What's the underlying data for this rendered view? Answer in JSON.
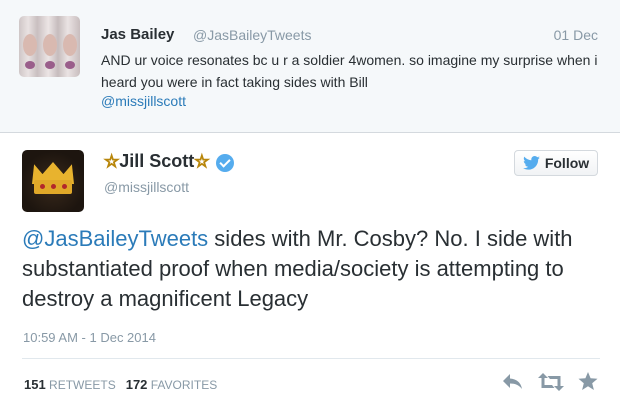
{
  "reply_context": {
    "author_name": "Jas Bailey",
    "author_handle": "@JasBaileyTweets",
    "date": "01 Dec",
    "text": "AND ur voice resonates bc u r a soldier 4women. so imagine my surprise when i heard you were in fact taking sides with Bill",
    "mention": "@missjillscott"
  },
  "tweet": {
    "author_name": "Jill Scott",
    "name_decoration": "☆",
    "author_handle": "@missjillscott",
    "follow_label": "Follow",
    "mention": "@JasBaileyTweets",
    "text": " sides with Mr. Cosby? No. I side with substantiated proof when media/society is attempting to destroy a magnificent Legacy",
    "timestamp": "10:59 AM - 1 Dec 2014",
    "retweets_count": "151",
    "retweets_label": "RETWEETS",
    "favorites_count": "172",
    "favorites_label": "FAVORITES"
  },
  "colors": {
    "link": "#2b7bb9",
    "muted": "#8899a6",
    "verified": "#55acee",
    "twitter_blue": "#55acee"
  },
  "icons": [
    "verified-badge-icon",
    "twitter-bird-icon",
    "reply-icon",
    "retweet-icon",
    "favorite-icon"
  ]
}
